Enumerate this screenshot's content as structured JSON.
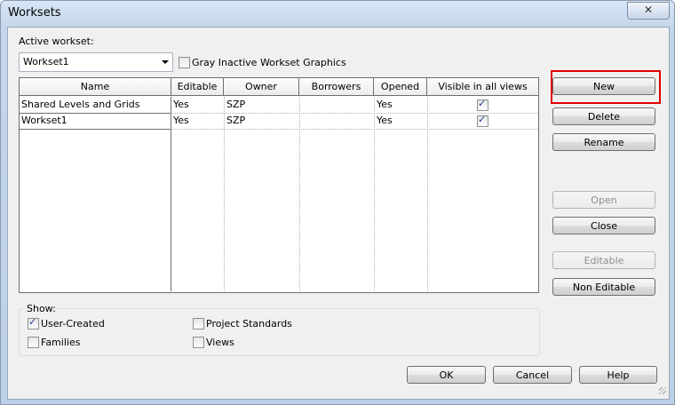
{
  "window": {
    "title": "Worksets",
    "close_glyph": "✕"
  },
  "active_workset": {
    "label": "Active workset:",
    "value": "Workset1"
  },
  "gray_inactive": {
    "label": "Gray Inactive Workset Graphics",
    "checked": false
  },
  "table": {
    "columns": [
      "Name",
      "Editable",
      "Owner",
      "Borrowers",
      "Opened",
      "Visible in all views"
    ],
    "rows": [
      {
        "name": "Shared Levels and Grids",
        "editable": "Yes",
        "owner": "SZP",
        "borrowers": "",
        "opened": "Yes",
        "visible": true
      },
      {
        "name": "Workset1",
        "editable": "Yes",
        "owner": "SZP",
        "borrowers": "",
        "opened": "Yes",
        "visible": true
      }
    ]
  },
  "buttons": {
    "new": "New",
    "delete": "Delete",
    "rename": "Rename",
    "open": "Open",
    "close": "Close",
    "editable": "Editable",
    "non_editable": "Non Editable",
    "ok": "OK",
    "cancel": "Cancel",
    "help": "Help"
  },
  "show": {
    "label": "Show:",
    "user_created": {
      "label": "User-Created",
      "checked": true
    },
    "families": {
      "label": "Families",
      "checked": false
    },
    "project_standards": {
      "label": "Project Standards",
      "checked": false
    },
    "views": {
      "label": "Views",
      "checked": false
    }
  },
  "colors": {
    "highlight": "#e00000"
  }
}
